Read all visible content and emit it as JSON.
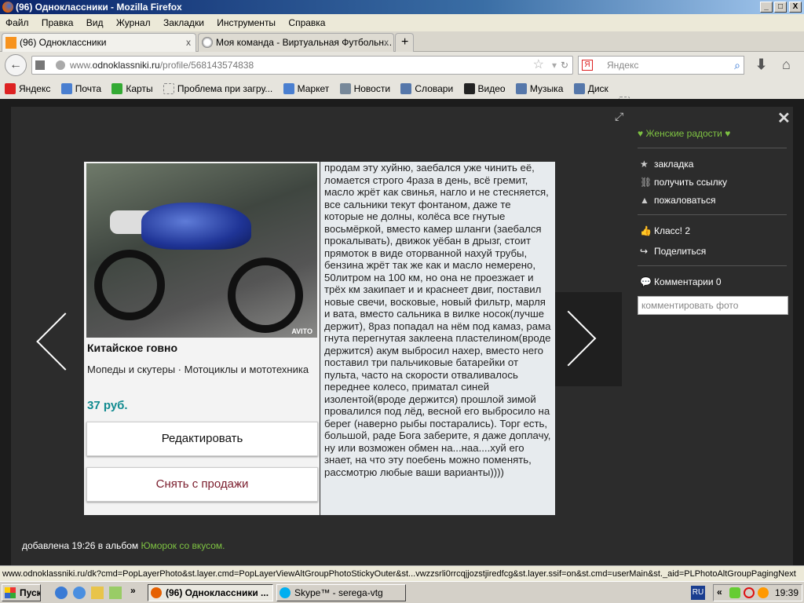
{
  "window": {
    "title": "(96) Одноклассники - Mozilla Firefox",
    "min": "_",
    "max": "□",
    "close": "X"
  },
  "menu": [
    "Файл",
    "Правка",
    "Вид",
    "Журнал",
    "Закладки",
    "Инструменты",
    "Справка"
  ],
  "tabs": [
    {
      "label": "(96) Одноклассники",
      "close": "x"
    },
    {
      "label": "Моя команда - Виртуальная Футбольн...",
      "close": "x"
    }
  ],
  "new_tab": "+",
  "address": {
    "host": "www.",
    "domain": "odnoklassniki.ru",
    "path": "/profile/568143574838"
  },
  "search": {
    "placeholder": "Яндекс"
  },
  "bookmarks": [
    {
      "label": "Яндекс",
      "color": "#d22"
    },
    {
      "label": "Почта",
      "color": "#4a7fd0"
    },
    {
      "label": "Карты",
      "color": "#3a3"
    },
    {
      "label": "Проблема при загру...",
      "color": "#ccc"
    },
    {
      "label": "Маркет",
      "color": "#4a7fd0"
    },
    {
      "label": "Новости",
      "color": "#789"
    },
    {
      "label": "Словари",
      "color": "#57a"
    },
    {
      "label": "Видео",
      "color": "#222"
    },
    {
      "label": "Музыка",
      "color": "#57a"
    },
    {
      "label": "Диск",
      "color": "#57a"
    }
  ],
  "ad": {
    "title": "Китайское говно",
    "category": "Мопеды и скутеры · Мотоциклы и мототехника",
    "price": "37 руб.",
    "edit_button": "Редактировать",
    "remove_button": "Снять с продажи",
    "watermark": "AVITO",
    "description": "продам эту хуйню, заебался уже чинить её, ломается строго 4раза в день, всё гремит, масло жрёт как свинья, нагло и не стесняется, все сальники текут фонтаном, даже те которые не долны, колёса все гнутые восьмёркой, вместо камер шланги (заебался прокалывать), движок уёбан в дрызг, стоит прямоток в виде оторванной нахуй трубы, бензина жрёт так же как и масло немерено, 50литром на 100 км, но она не проезжает и трёх км закипает и и краснеет двиг, поставил новые свечи, восковые, новый фильтр, марля и вата, вместо сальника в вилке носок(лучше держит), 8раз попадал на нём под камаз, рама гнута перегнутая заклеена пластелином(вроде держится) акум выбросил нахер, вместо него поставил три пальчиковые батарейки от пульта, часто на скорости отваливалось переднее колесо, приматал синей изолентой(вроде держится) прошлой зимой провалился под лёд, весной его выбросило на берег (наверно рыбы постарались). Торг есть, большой, раде Бога заберите, я даже доплачу, ну или возможен обмен на...наа....хуй его знает, на что эту поебень можно поменять, рассмотрю любые ваши варианты))))"
  },
  "side": {
    "group": "♥ Женские радости ♥",
    "bookmark": "закладка",
    "get_link": "получить ссылку",
    "report": "пожаловаться",
    "like": "Класс! 2",
    "share": "Поделиться",
    "comments": "Комментарии 0",
    "comment_placeholder": "комментировать фото",
    "close": "✕"
  },
  "added": {
    "prefix": "добавлена 19:26 в альбом ",
    "album": "Юморок со вкусом."
  },
  "status_url": "www.odnoklassniki.ru/dk?cmd=PopLayerPhoto&st.layer.cmd=PopLayerViewAltGroupPhotoStickyOuter&st...vwzzsrli0rrcqjjozstjiredfcg&st.layer.ssif=on&st.cmd=userMain&st._aid=PLPhotoAltGroupPagingNext",
  "taskbar": {
    "start": "Пуск",
    "chevron": "»",
    "tasks": [
      "(96) Одноклассники ...",
      "Skype™ - serega-vtg"
    ],
    "lang": "RU",
    "tray_chevron": "«",
    "clock": "19:39"
  },
  "colors": {
    "accent_green": "#7ec242",
    "price": "#0f8a8f",
    "remove": "#7a1c2c"
  }
}
